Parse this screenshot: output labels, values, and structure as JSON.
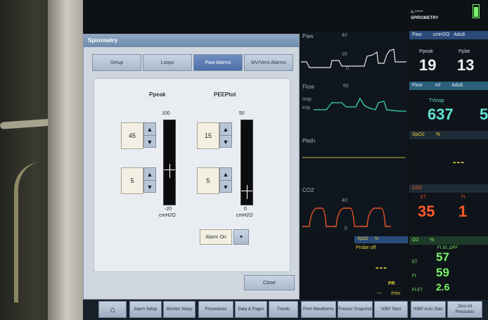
{
  "monitor": {
    "patient_id": "X-*****",
    "mode": "SPIROMETRY",
    "waves": {
      "paw_label": "Paw",
      "paw_scale_top": "40",
      "paw_scale_mid": "20",
      "paw_scale_zero": "0",
      "flow_label": "Flow",
      "flow_scale_top": "60",
      "flow_insp": "insp",
      "flow_exp": "exp",
      "pleth_label": "Pleth",
      "co2_label": "CO2",
      "co2_scale_top": "40",
      "co2_scale_zero": "0"
    },
    "numerics": {
      "paw_header": "Paw",
      "paw_unit": "cmH2O",
      "paw_age": "Adult",
      "ppeak_label": "Ppeak",
      "ppeak_value": "19",
      "pplat_label": "Pplat",
      "pplat_value": "13",
      "flow_header": "Flow",
      "flow_unit": "ml",
      "flow_age": "Adult",
      "tvinsp_label": "TVinsp",
      "tvinsp_value": "637",
      "tvinsp_value2": "5",
      "spo2_header": "SpO2",
      "spo2_unit": "%",
      "spo2_value": "---",
      "co2_header": "CO2",
      "et_label": "ET",
      "et_value": "35",
      "fi_label": "FI",
      "fi_value": "1",
      "o2_header": "O2",
      "o2_unit": "%",
      "o2_note": "FI 30.,OFF",
      "o2_et_label": "ET",
      "o2_et_value": "57",
      "o2_fi_label": "FI",
      "o2_fi_value": "59",
      "o2_fiet_label": "FI-ET",
      "o2_fiet_value": "2.6"
    },
    "spo2_small": {
      "header": "SpO2",
      "unit": "%",
      "status": "Probe off",
      "value": "---",
      "pr_label": "PR",
      "pr_value": "---",
      "pr_unit": "/min"
    },
    "bottom_bar": [
      {
        "label": "Alarm Setup"
      },
      {
        "label": "Monitor Setup"
      },
      {
        "label": "Procedures"
      },
      {
        "label": "Data & Pages"
      },
      {
        "label": "Trends"
      },
      {
        "label": "Print Waveforms"
      },
      {
        "label": "Freeze/ Snapshot"
      },
      {
        "label": "NIBP Start"
      },
      {
        "label": "NIBP Auto Start"
      },
      {
        "label": "Zero All Pressures"
      }
    ]
  },
  "dialog": {
    "title": "Spirometry",
    "tabs": [
      {
        "label": "Setup",
        "active": false
      },
      {
        "label": "Loops",
        "active": false
      },
      {
        "label": "Paw Alarms",
        "active": true
      },
      {
        "label": "MV/Vent Alarms",
        "active": false
      }
    ],
    "ppeak": {
      "label": "Ppeak",
      "high": "45",
      "low": "5",
      "scale_max": "100",
      "scale_min": "-20",
      "unit": "cmH2O"
    },
    "peeptot": {
      "label": "PEEPtot",
      "high": "15",
      "low": "5",
      "scale_max": "50",
      "scale_min": "0",
      "unit": "cmH2O"
    },
    "alarm_select": "Alarm On",
    "close_label": "Close"
  },
  "colors": {
    "paw_wave": "#e6e6e6",
    "flow_wave": "#39d3b6",
    "pleth_wave": "#c9b640",
    "co2_wave": "#e8552a",
    "numeric_green": "#7cf46a",
    "numeric_cyan": "#5fe2d4",
    "numeric_red": "#ff5a2a",
    "spo2_yellow": "#e7d43a"
  }
}
